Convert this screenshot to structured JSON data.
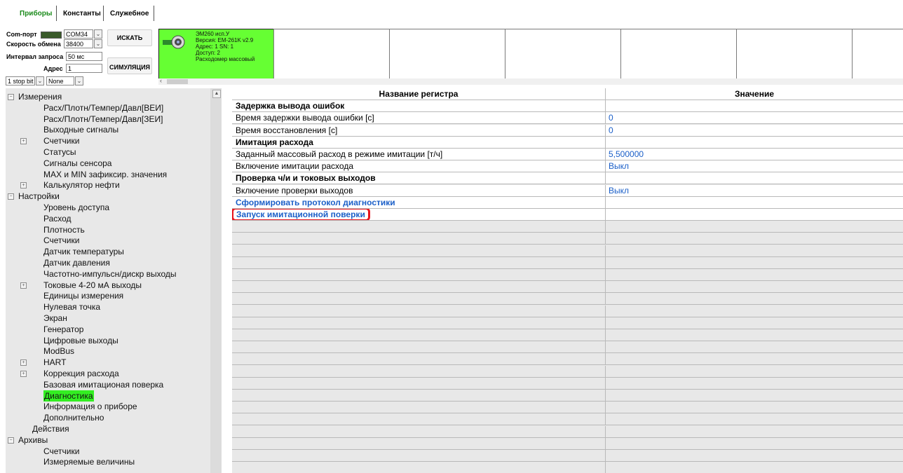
{
  "tabs": [
    {
      "label": "Приборы",
      "color": "#1a8a1a"
    },
    {
      "label": "Константы"
    },
    {
      "label": "Служебное"
    }
  ],
  "connection": {
    "com_port_label": "Com-порт",
    "com_port_value": "COM34",
    "speed_label": "Скорость обмена",
    "speed_value": "38400",
    "interval_label": "Интервал запроса",
    "interval_value": "50 мс",
    "address_label": "Адрес",
    "address_value": "1",
    "stop_bits_value": "1 stop bit",
    "parity_value": "None",
    "search_button": "ИСКАТЬ",
    "simulation_button": "СИМУЛЯЦИЯ"
  },
  "device": {
    "line1": "ЭМ260 исп.У",
    "line2": "Версия: EM-261K v2.9",
    "line3": "Адрес: 1 SN: 1",
    "line4": "Доступ: 2",
    "line5": "Расходомер массовый",
    "card_color": "#66ff33",
    "status_led_color": "#2a6a2a"
  },
  "tree": [
    {
      "label": "Измерения",
      "level": 0,
      "expander": "minus"
    },
    {
      "label": "Расх/Плотн/Темпер/Давл[ВЕИ]",
      "level": 1
    },
    {
      "label": "Расх/Плотн/Темпер/Давл[ЗЕИ]",
      "level": 1
    },
    {
      "label": "Выходные сигналы",
      "level": 1
    },
    {
      "label": "Счетчики",
      "level": 1,
      "expander": "plus"
    },
    {
      "label": "Статусы",
      "level": 1
    },
    {
      "label": "Сигналы сенсора",
      "level": 1
    },
    {
      "label": "MAX и MIN зафиксир. значения",
      "level": 1
    },
    {
      "label": "Калькулятор нефти",
      "level": 1,
      "expander": "plus"
    },
    {
      "label": "Настройки",
      "level": 0,
      "expander": "minus"
    },
    {
      "label": "Уровень доступа",
      "level": 1
    },
    {
      "label": "Расход",
      "level": 1
    },
    {
      "label": "Плотность",
      "level": 1
    },
    {
      "label": "Счетчики",
      "level": 1
    },
    {
      "label": "Датчик температуры",
      "level": 1
    },
    {
      "label": "Датчик давления",
      "level": 1
    },
    {
      "label": "Частотно-импульсн/дискр выходы",
      "level": 1
    },
    {
      "label": "Токовые 4-20 мА выходы",
      "level": 1,
      "expander": "plus"
    },
    {
      "label": "Единицы измерения",
      "level": 1
    },
    {
      "label": "Нулевая точка",
      "level": 1
    },
    {
      "label": "Экран",
      "level": 1
    },
    {
      "label": "Генератор",
      "level": 1
    },
    {
      "label": "Цифровые выходы",
      "level": 1
    },
    {
      "label": "ModBus",
      "level": 1
    },
    {
      "label": "HART",
      "level": 1,
      "expander": "plus"
    },
    {
      "label": "Коррекция расхода",
      "level": 1,
      "expander": "plus"
    },
    {
      "label": "Базовая имитационая поверка",
      "level": 1
    },
    {
      "label": "Диагностика",
      "level": 1,
      "selected": true
    },
    {
      "label": "Информация о приборе",
      "level": 1
    },
    {
      "label": "Дополнительно",
      "level": 1
    },
    {
      "label": "Действия",
      "level": 0.5
    },
    {
      "label": "Архивы",
      "level": 0,
      "expander": "minus"
    },
    {
      "label": "Счетчики",
      "level": 1
    },
    {
      "label": "Измеряемые величины",
      "level": 1
    }
  ],
  "tree_selected_color": "#33ee22",
  "grid": {
    "col_name_header": "Название регистра",
    "col_value_header": "Значение",
    "rows": [
      {
        "name": "Задержка вывода ошибок",
        "type": "section"
      },
      {
        "name": "Время задержки вывода ошибки [с]",
        "value": "0"
      },
      {
        "name": "Время восстановления [с]",
        "value": "0"
      },
      {
        "name": "Имитация расхода",
        "type": "section"
      },
      {
        "name": "Заданный массовый расход в режиме имитации [т/ч]",
        "value": "5,500000"
      },
      {
        "name": "Включение имитации расхода",
        "value": "Выкл"
      },
      {
        "name": "Проверка ч/и и токовых выходов",
        "type": "section"
      },
      {
        "name": "Включение проверки выходов",
        "value": "Выкл"
      },
      {
        "name": "Сформировать протокол диагностики",
        "type": "link"
      },
      {
        "name": "Запуск имитационной поверки",
        "type": "link",
        "highlighted": true
      }
    ],
    "highlight_color": "#e8141c"
  }
}
